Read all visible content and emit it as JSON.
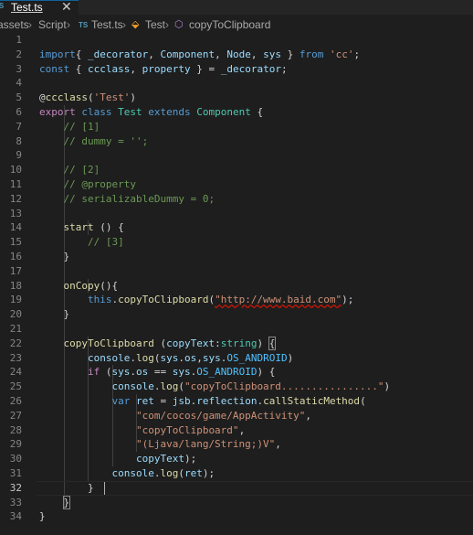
{
  "tab": {
    "icon": "TS",
    "label": "Test.ts",
    "close": "✕"
  },
  "breadcrumb": {
    "items": [
      "assets",
      "Script",
      "Test.ts",
      "Test",
      "copyToClipboard"
    ],
    "separator": "›",
    "icons": [
      "typescript-file-icon",
      "class-icon",
      "method-icon"
    ]
  },
  "editor": {
    "current_line": 32,
    "lines": [
      [],
      [
        [
          "kw",
          "import"
        ],
        [
          "",
          "{ "
        ],
        [
          "var",
          "_decorator"
        ],
        [
          "",
          ", "
        ],
        [
          "var",
          "Component"
        ],
        [
          "",
          ", "
        ],
        [
          "var",
          "Node"
        ],
        [
          "",
          ", "
        ],
        [
          "var",
          "sys"
        ],
        [
          "",
          " } "
        ],
        [
          "kw",
          "from"
        ],
        [
          "",
          " "
        ],
        [
          "str",
          "'cc'"
        ],
        [
          "",
          ";"
        ]
      ],
      [
        [
          "kw",
          "const"
        ],
        [
          "",
          " { "
        ],
        [
          "var",
          "ccclass"
        ],
        [
          "",
          ", "
        ],
        [
          "var",
          "property"
        ],
        [
          "",
          " } = "
        ],
        [
          "var",
          "_decorator"
        ],
        [
          "",
          ";"
        ]
      ],
      [],
      [
        [
          "",
          "@"
        ],
        [
          "fn",
          "ccclass"
        ],
        [
          "",
          "("
        ],
        [
          "str",
          "'Test'"
        ],
        [
          "",
          ")"
        ]
      ],
      [
        [
          "ctl",
          "export"
        ],
        [
          "",
          " "
        ],
        [
          "kw",
          "class"
        ],
        [
          "",
          " "
        ],
        [
          "cls",
          "Test"
        ],
        [
          "",
          " "
        ],
        [
          "kw",
          "extends"
        ],
        [
          "",
          " "
        ],
        [
          "cls",
          "Component"
        ],
        [
          "",
          " {"
        ]
      ],
      [
        [
          "",
          "    "
        ],
        [
          "cm",
          "// [1]"
        ]
      ],
      [
        [
          "",
          "    "
        ],
        [
          "cm",
          "// dummy = '';"
        ]
      ],
      [],
      [
        [
          "",
          "    "
        ],
        [
          "cm",
          "// [2]"
        ]
      ],
      [
        [
          "",
          "    "
        ],
        [
          "cm",
          "// @property"
        ]
      ],
      [
        [
          "",
          "    "
        ],
        [
          "cm",
          "// serializableDummy = 0;"
        ]
      ],
      [],
      [
        [
          "",
          "    "
        ],
        [
          "fn",
          "start"
        ],
        [
          "",
          " () {"
        ]
      ],
      [
        [
          "",
          "        "
        ],
        [
          "cm",
          "// [3]"
        ]
      ],
      [
        [
          "",
          "    }"
        ]
      ],
      [],
      [
        [
          "",
          "    "
        ],
        [
          "fn",
          "onCopy"
        ],
        [
          "",
          "(){"
        ]
      ],
      [
        [
          "",
          "        "
        ],
        [
          "kw",
          "this"
        ],
        [
          "",
          "."
        ],
        [
          "fn",
          "copyToClipboard"
        ],
        [
          "",
          "("
        ],
        [
          "str",
          "\""
        ],
        [
          "str link",
          "http://www.baid.com"
        ],
        [
          "str",
          "\""
        ],
        [
          "",
          ");"
        ]
      ],
      [
        [
          "",
          "    }"
        ]
      ],
      [],
      [
        [
          "",
          "    "
        ],
        [
          "fn",
          "copyToClipboard"
        ],
        [
          "",
          " ("
        ],
        [
          "var",
          "copyText"
        ],
        [
          "",
          ":"
        ],
        [
          "cls",
          "string"
        ],
        [
          "",
          ") "
        ],
        [
          "bmatch",
          "{"
        ]
      ],
      [
        [
          "",
          "        "
        ],
        [
          "var",
          "console"
        ],
        [
          "",
          "."
        ],
        [
          "fn",
          "log"
        ],
        [
          "",
          "("
        ],
        [
          "var",
          "sys"
        ],
        [
          "",
          "."
        ],
        [
          "var",
          "os"
        ],
        [
          "",
          ","
        ],
        [
          "var",
          "sys"
        ],
        [
          "",
          "."
        ],
        [
          "con",
          "OS_ANDROID"
        ],
        [
          "",
          ")"
        ]
      ],
      [
        [
          "",
          "        "
        ],
        [
          "ctl",
          "if"
        ],
        [
          "",
          " ("
        ],
        [
          "var",
          "sys"
        ],
        [
          "",
          "."
        ],
        [
          "var",
          "os"
        ],
        [
          "",
          " == "
        ],
        [
          "var",
          "sys"
        ],
        [
          "",
          "."
        ],
        [
          "con",
          "OS_ANDROID"
        ],
        [
          "",
          ") {"
        ]
      ],
      [
        [
          "",
          "            "
        ],
        [
          "var",
          "console"
        ],
        [
          "",
          "."
        ],
        [
          "fn",
          "log"
        ],
        [
          "",
          "("
        ],
        [
          "str",
          "\"copyToClipboard................\""
        ],
        [
          "",
          ")"
        ]
      ],
      [
        [
          "",
          "            "
        ],
        [
          "kw",
          "var"
        ],
        [
          "",
          " "
        ],
        [
          "var",
          "ret"
        ],
        [
          "",
          " = "
        ],
        [
          "var",
          "jsb"
        ],
        [
          "",
          "."
        ],
        [
          "var",
          "reflection"
        ],
        [
          "",
          "."
        ],
        [
          "fn",
          "callStaticMethod"
        ],
        [
          "",
          "("
        ]
      ],
      [
        [
          "",
          "                "
        ],
        [
          "str",
          "\"com/cocos/game/AppActivity\""
        ],
        [
          "",
          ","
        ]
      ],
      [
        [
          "",
          "                "
        ],
        [
          "str",
          "\"copyToClipboard\""
        ],
        [
          "",
          ","
        ]
      ],
      [
        [
          "",
          "                "
        ],
        [
          "str",
          "\"(Ljava/lang/String;)V\""
        ],
        [
          "",
          ","
        ]
      ],
      [
        [
          "",
          "                "
        ],
        [
          "var",
          "copyText"
        ],
        [
          "",
          ");"
        ]
      ],
      [
        [
          "",
          "            "
        ],
        [
          "var",
          "console"
        ],
        [
          "",
          "."
        ],
        [
          "fn",
          "log"
        ],
        [
          "",
          "("
        ],
        [
          "var",
          "ret"
        ],
        [
          "",
          ");"
        ]
      ],
      [
        [
          "",
          "        }"
        ]
      ],
      [
        [
          "",
          "    "
        ],
        [
          "bmatch",
          "}"
        ]
      ],
      [
        [
          "",
          "}"
        ]
      ]
    ]
  },
  "colors": {
    "background": "#1e1e1e",
    "keyword": "#569cd6",
    "control": "#c586c0",
    "string": "#ce9178",
    "comment": "#6a9955",
    "type": "#4ec9b0",
    "function": "#dcdcaa",
    "variable": "#9cdcfe",
    "constant": "#4fc1ff"
  }
}
